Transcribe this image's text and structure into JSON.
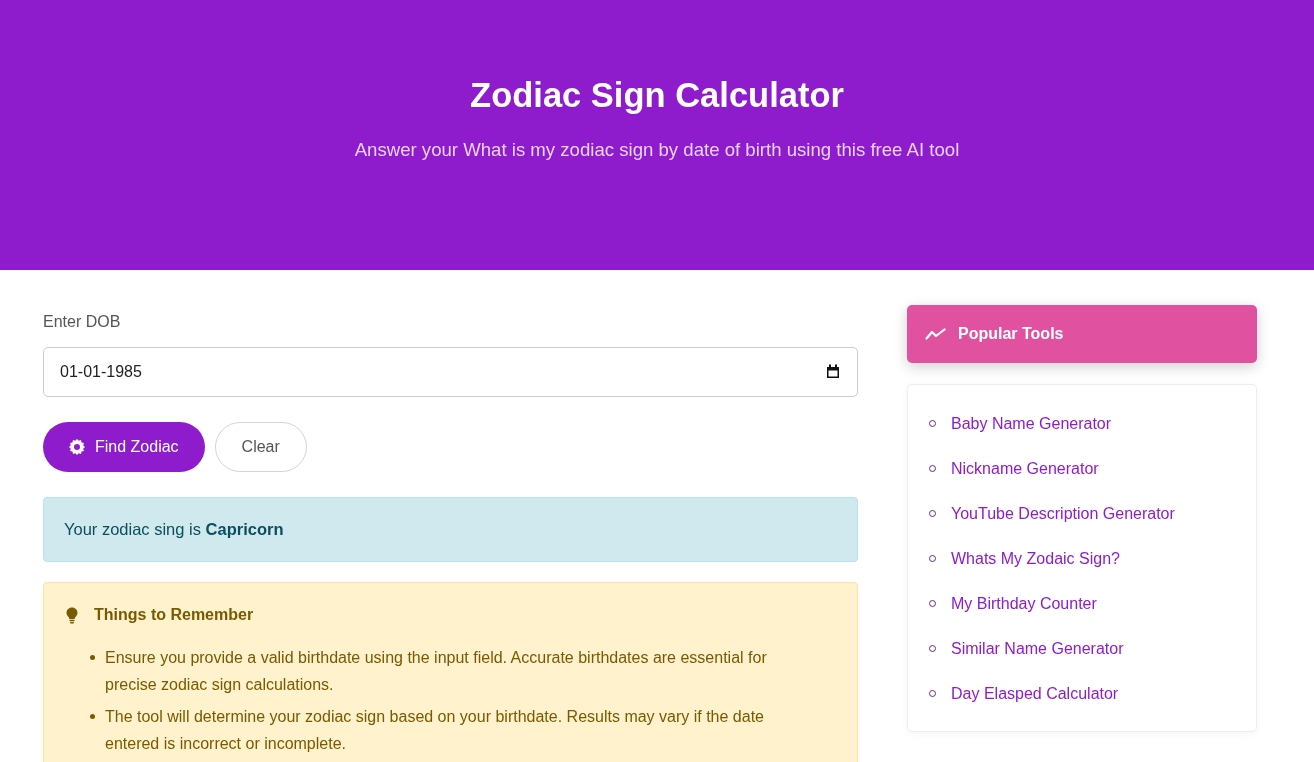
{
  "header": {
    "title": "Zodiac Sign Calculator",
    "subtitle": "Answer your What is my zodiac sign by date of birth using this free AI tool"
  },
  "form": {
    "label": "Enter DOB",
    "dob_value": "01-01-1985",
    "buttons": [
      {
        "kind": "primary",
        "label": "Find Zodiac"
      },
      {
        "kind": "secondary",
        "label": "Clear"
      }
    ]
  },
  "result": {
    "text": "Your zodiac sing is **Capricorn**"
  },
  "notes": {
    "title": "Things to Remember",
    "items": [
      "Ensure you provide a valid birthdate using the input field. Accurate birthdates are essential for precise zodiac sign calculations.",
      "The tool will determine your zodiac sign based on your birthdate. Results may vary if the date entered is incorrect or incomplete."
    ]
  },
  "popular_tools": {
    "title": "Popular Tools",
    "items": [
      "Baby Name Generator",
      "Nickname Generator",
      "YouTube Description Generator",
      "Whats My Zodaic Sign?",
      "My Birthday Counter",
      "Similar Name Generator",
      "Day Elasped Calculator"
    ]
  }
}
